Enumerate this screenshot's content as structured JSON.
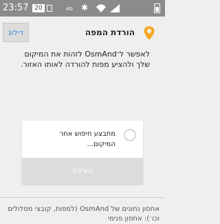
{
  "status_bar": {
    "time": "23:57",
    "badge": "20",
    "network": "4G",
    "bluetooth": "✱",
    "icons": [
      "sim-icon",
      "bluetooth-icon",
      "wifi-icon",
      "signal-icon",
      "battery-icon"
    ],
    "battery_level": 0.5
  },
  "header": {
    "title": "הורדת המפה",
    "skip_label": "דילוג",
    "icon": "location-pin-icon",
    "accent_color": "#f5a623"
  },
  "description": "לאפשר ל־OsmAnd לזהות את המיקום שלך ולהציע מפות להורדה לאותו האזור.",
  "search_card": {
    "status_text": "מתבצע חיפוש אחר המיקום...",
    "download_label": "הורדה",
    "icon": "spinner-icon"
  },
  "footer": {
    "text": "אחסון נתונים של OsmAnd (למפות, קובצי מסלולים וכו׳): אחסון פנימי"
  }
}
